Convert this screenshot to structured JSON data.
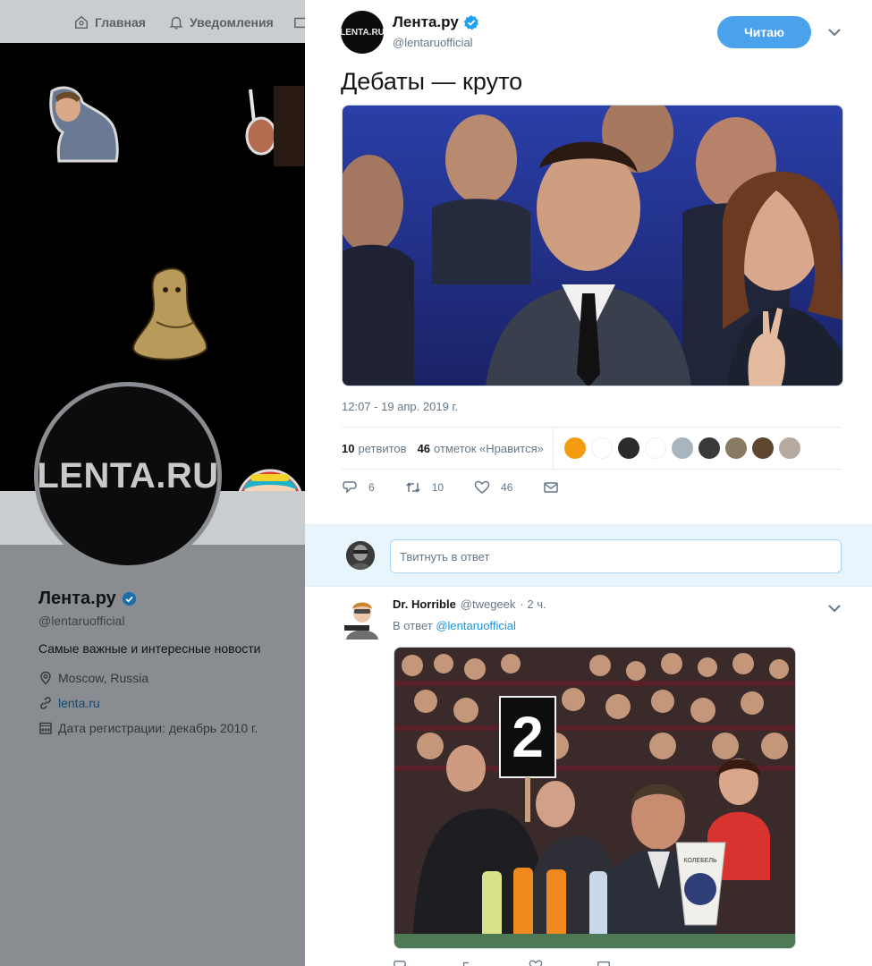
{
  "nav": {
    "home_label": "Главная",
    "notifications_label": "Уведомления"
  },
  "profile": {
    "avatar_text": "LENTA.RU",
    "name": "Лента.ру",
    "handle": "@lentaruofficial",
    "bio": "Самые важные и интересные новости",
    "location": "Moscow, Russia",
    "website": "lenta.ru",
    "joined": "Дата регистрации: декабрь 2010 г."
  },
  "tweet": {
    "avatar_text": "LENTA.RU",
    "author_name": "Лента.ру",
    "author_handle": "@lentaruofficial",
    "follow_label": "Читаю",
    "text": "Дебаты — круто",
    "timestamp": "12:07 - 19 апр. 2019 г.",
    "retweets_count": "10",
    "retweets_label": "ретвитов",
    "likes_count": "46",
    "likes_label": "отметок «Нравится»",
    "actions": {
      "reply_count": "6",
      "retweet_count": "10",
      "like_count": "46"
    },
    "liker_colors": [
      "#f39c12",
      "#ffffff",
      "#2b2b2b",
      "#ffffff",
      "#a8b4be",
      "#3a3a3a",
      "#8b7a63",
      "#5e4630",
      "#b5a9a0"
    ]
  },
  "reply_box": {
    "placeholder": "Твитнуть в ответ"
  },
  "reply": {
    "author_name": "Dr. Horrible",
    "author_handle": "@twegeek",
    "time": "· 2 ч.",
    "reply_to_prefix": "В ответ",
    "reply_to_handle": "@lentaruofficial",
    "sign_number": "2",
    "table_sign": "КОЛЕБЕЛЬ"
  },
  "colors": {
    "accent": "#1da1f2",
    "follow_button": "#4aa1ec",
    "verified": "#1da1f2"
  }
}
